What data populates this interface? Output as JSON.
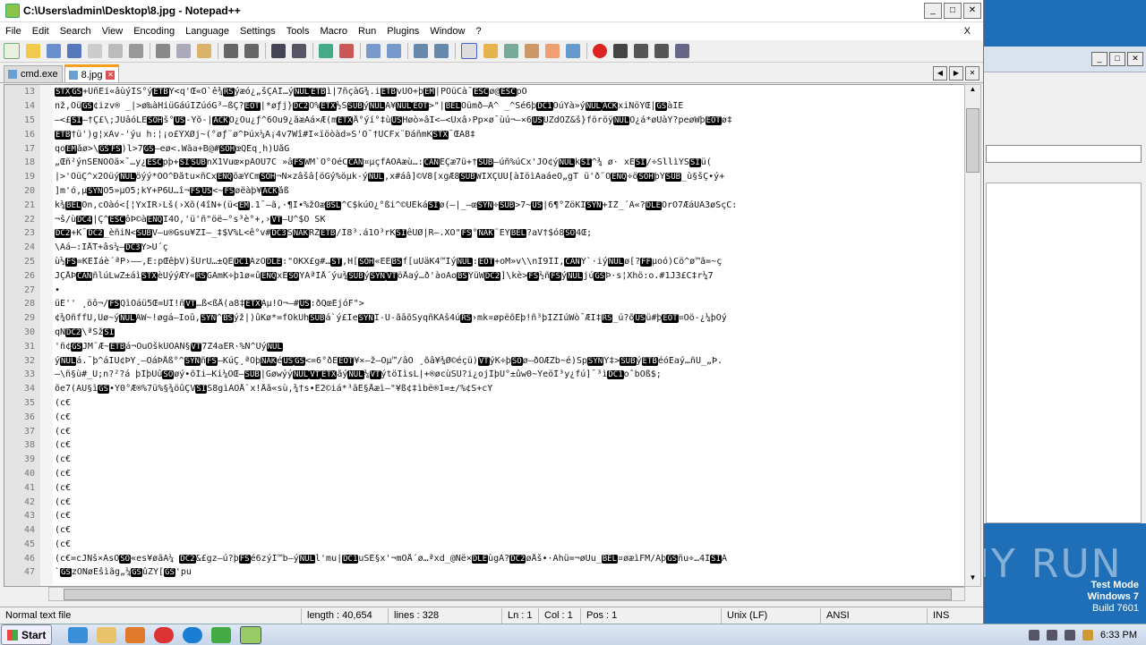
{
  "window": {
    "title": "C:\\Users\\admin\\Desktop\\8.jpg - Notepad++"
  },
  "menu": [
    "File",
    "Edit",
    "Search",
    "View",
    "Encoding",
    "Language",
    "Settings",
    "Tools",
    "Macro",
    "Run",
    "Plugins",
    "Window",
    "?"
  ],
  "menu_close": "X",
  "tabs": [
    {
      "label": "cmd.exe",
      "active": false
    },
    {
      "label": "8.jpg",
      "active": true
    }
  ],
  "lines": [
    {
      "n": "13",
      "t": "STXGS+UñEí«âùýÌS°ýETBÝ<q'Œ«O`ê¾RSýæó¿„šÇÂÌ…ýNULETBì|7ñçàG¾.iETBvÚO+þEM|PÕüCà¯ESCø@ESCpÒ"
    },
    {
      "n": "14",
      "t": "nž,ÕüGS¢izv® _|>ø‰àHiüGáúÍZúóG³–ßÇ?EOT|*øƒj}DC2Õ%ETX½SSUBýNULA¥NULEOT>\"|BELÕümð—Á^ _^Sé6þDC1ÕúYà»ýNULACKxiNöŸŒ|GSàÎE"
    },
    {
      "n": "15",
      "t": "–<£SI–†Ç£\\;JUâóLÈSOHš°US-Ÿõ-|ACKÔ¿Óu¿ƒ^6Ou9¿ãæÄá×Æ(mETXÅ°ýí°‡ùUSHøò»âÍ<–<Üxâ›Pp×ø¯ùú¬–×6USÚZdÖZ&š}föröÿNULÓ¿á*øÙàŸ?peøWþEOTø‡"
    },
    {
      "n": "16",
      "t": "    ETB†ü')g¦xÂv-'ýu    h:¦¡o£ÝXØj~(°øƒ¨ø^Þúx¼A¡4v7Wî#I«ïöòàd»Š'Ö¯†ÜCFx¨ÐáñmKSTX¯ŒÁ8‡"
    },
    {
      "n": "17",
      "t": "qoEMåø>\\GSFS)l>7GS–eø<.Wãa+B@#SOHœQÊq¸h)UåG"
    },
    {
      "n": "18",
      "t": "„Œñ²ýnSENOÕã×¯…y¿ESCpþ+SISUBnX1Vuœ×pÂÓU7C  »âFSWM`Ó°ÕéCCAN¤µçfÀÖÃæù…:CANÊÇæ7ü+†SUB–úñ%úCx'JÓ¢ýNULkSI^¾   ø·  xÊSI/÷SllìÝSSIü("
    },
    {
      "n": "19",
      "t": "|>'ÕüÇ^x2OüýNULöýý*ÔÔ^Ðåtu×ñCxENQõæÝCmSOH¬N×zâšâ[öGý%öµk-ýNUL,x#áâ]©V8[xgÆ8SUBWIXÇÜÙ[àÌöìÀaáeÓ„gT ü'ð¨ÒENQ÷öSOHþÝSUB_ù§šÇ•ý+"
    },
    {
      "n": "20",
      "t": "]m'ó,µSYNÓ5»µÓ5;kÝ+P6Ü…î¬FSUS<~FSøëàþ¥ACKåß"
    },
    {
      "n": "21",
      "t": "k¾BELÕn,cÖàó<[¦ÝxÍR›Lš(›Xõ(4îN+(ü<EM.1¯–ã,·¶Ì•%žÕæBSL^C$kúO¿°ßi^©ÜÈkáSIø(—|_–œSYN÷SUB>7~US|6¶°ŽöKÍSYN+ÌŽ_´Â«?DLEOrÓ7ÆáÛÂ3øŠçC:"
    },
    {
      "n": "22",
      "t": "¬š/ùDC4|Ç^ESCôÞ©àENQI4O,'ü'ñ\"öë–°s³è°+,›VT–Ú^$Õ ŠK"
    },
    {
      "n": "23",
      "t": "DC2+K¯DC2_èñiÑ<SUBV–u®Gsu¥ZÏ–_‡$V%L<ê°v#DC3SNAKRŽETB/Î8³.á1Ö³rKSIêÜØ|R–.XÕ\"FS°NAK¨ÈÝBEL?aV†$ó8SO4Œ;"
    },
    {
      "n": "24",
      "t": "\\Àá–:ÏÅT+âs¼–DC3Y>Ú´ç"
    },
    {
      "n": "25",
      "t": "ù½FS=KEÎáè´ªP›——,E:pŒêþV)šÜrÜ…±QÉDC1ÀzÖDLE:\"ÕKX£g#…ST,H[SOH«EÈBSf[uÙäK4™ÎýNUL:EOT+oM»v\\\\nÌ9ÎÎ,CANÝ`·iýNULø[?FFµoó)Cö^ø™ã=~ç"
    },
    {
      "n": "26",
      "t": "JÇÅÞCANñlúLwZ±áìSTXèÜýýÆÝ«RSGÂmK÷þ1ø«ûENQxÊSOÝÀªÌÅ´ýu¾SUBýSYNVTöÅaý…ð'àoÀoBSÝüWDC2]\\kè>FS½ñFSýNULjúGSÞ·s¦Xhö:o.#1J3£C‡r¼7"
    },
    {
      "n": "27",
      "t": "•"
    },
    {
      "n": "28",
      "t": "üÉ''     ¸öô¬/FSQìÕáü5Œ=ÜÌ!ñVT…ß<ßÅ(a8‡ETXÃµ!O¬–#US:ðQœÈjóF\">"
    },
    {
      "n": "29",
      "t": "¢¾ÓñffÛ,Ûø~ýNULAW~!øgá–Ïoû,SYN^BSýž|)ûKø*=fÖkÙhSUBá`ý£ÌeSYNÍ-Û-åâõŠyqñKÂš4úRS›mk¤øpëõÊþ!ñ³þÌZÌúWò¯ÆÌ‡RS_ú?õUSü#þEOT¤Õö-¿¼þÕý"
    },
    {
      "n": "30",
      "t": "qNDC2\\ªSžSI"
    },
    {
      "n": "31",
      "t": "'ñ¢GSJM¨Æ~ETBá¬ÖuÔškÚÓÄÑ§VT7Z4aËR·%Ñ^ÜýNUL"
    },
    {
      "n": "32",
      "t": "ýNULá.¯þ^áÌÜ¢ÞÝ¸–ÔáÞÅß°^SYNñFS–KúÇ¸ªÓþNAKéUSGS<=6°ðÈEOT¥×–ž–Óµ™/âÓ ¸õâ¥¾Ø©éçü)VTýK÷þSOø–ðOÆZb~é)SpSYNÝ‡>SUBýETBéóÈaý…ñÚ_„Þ."
    },
    {
      "n": "33",
      "t": "—\\ñ§ù#_Ú;n?²?á þÌþÜûSOøý•õÌi–Ki¼OŒ–SUB|GøwýýNULVTETXåýNUL¼VTýtöÌìsL|+®øcùSÜ?i¿ojÎþÛ°±ûw0~ŸeöÎ³y¿fú]¯³ìDC1oˆbÖß$;"
    },
    {
      "n": "34",
      "t": "õe7(AU§ìGS•Ÿ0°Æ®%7ü%§¾öûÇVSIŠ8gìÀÓÅ`x!Åå«sù,¾†s•Ë2©iá*³ãÊ§Åæì–\"¥ß¢‡ìbë®1=±/%¢Š+cŸ"
    },
    {
      "n": "35",
      "t": "(c€"
    },
    {
      "n": "36",
      "t": "(c€"
    },
    {
      "n": "37",
      "t": "(c€"
    },
    {
      "n": "38",
      "t": "(c€"
    },
    {
      "n": "39",
      "t": "(c€"
    },
    {
      "n": "40",
      "t": "(c€"
    },
    {
      "n": "41",
      "t": "(c€"
    },
    {
      "n": "42",
      "t": "(c€"
    },
    {
      "n": "43",
      "t": "(c€"
    },
    {
      "n": "44",
      "t": "(c€"
    },
    {
      "n": "45",
      "t": "(c€"
    },
    {
      "n": "46",
      "t": "(c€=cJÑš×ÀsOSO«es¥øãÃ¼ DC2&£gz–ú?þFSé6zýÎ™b–ýNULl'mu|DC1uŠÈ§x'¬mÕÅ´ø…ªxd_@Ñë×DLEùgÀ?DC2øÅš•·Ähü=¬øÙu_BEL¤øæìFM/ÂþGSñu÷…4ÍSIÁ"
    },
    {
      "n": "47",
      "t": "`GSzÓNøÈšìãg„¼GSûZY[GS'pu"
    }
  ],
  "status": {
    "type": "Normal text file",
    "length": "length : 40,654",
    "lines": "lines : 328",
    "ln": "Ln : 1",
    "col": "Col : 1",
    "pos": "Pos : 1",
    "eol": "Unix (LF)",
    "encoding": "ANSI",
    "mode": "INS"
  },
  "taskbar": {
    "start": "Start",
    "clock": "6:33 PM"
  },
  "watermark": "ANY RUN",
  "wininfo": {
    "line1": "Test Mode",
    "line2": "Windows 7",
    "line3": "Build 7601"
  },
  "colors": {
    "active_tab_accent": "#f8a01c",
    "desktop": "#1f6fb8"
  }
}
